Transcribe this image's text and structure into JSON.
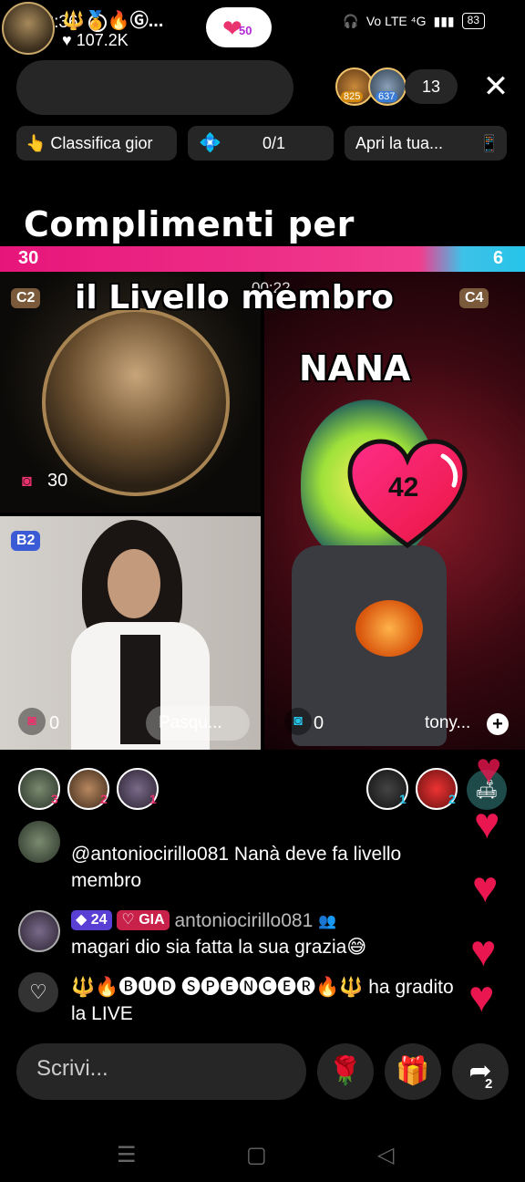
{
  "status": {
    "time": "23:36",
    "right_label": "Vo LTE ⁴G",
    "battery": "83"
  },
  "host": {
    "name": "🔱🏅🔥Ⓖ...",
    "likes": "♥ 107.2K",
    "follow_count": "50"
  },
  "viewers": {
    "v1_badge": "825",
    "v2_badge": "637",
    "count": "13"
  },
  "pills": {
    "ranking": "👆 Classifica gior",
    "progress": "0/1",
    "open": "Apri la tua..."
  },
  "overlay": {
    "congrats": "Complimenti per",
    "level": "il Livello membro",
    "timer": "00:22",
    "nana": "NANA"
  },
  "pk": {
    "left": "30",
    "right": "6"
  },
  "tiles": {
    "t1": {
      "badge": "C2",
      "count": "30"
    },
    "t2": {
      "badge": "C4",
      "heart_value": "42"
    },
    "t3": {
      "badge": "B2",
      "count": "0",
      "name": "Pasqu..."
    },
    "t4": {
      "count": "0",
      "name": "tony..."
    }
  },
  "gifters": {
    "left": [
      "3",
      "2",
      "1"
    ],
    "right": [
      "1",
      "2"
    ]
  },
  "chat": {
    "m1": {
      "text": "@antoniocirillo081 Nanà deve fa livello membro"
    },
    "m2": {
      "level": "24",
      "tag": "GIA",
      "user": "antoniocirillo081",
      "text": "magari dio sia fatta la sua grazia😅"
    },
    "m3": {
      "text": "🔱🔥🅑🅤🅓 🅢🅟🅔🅝🅒🅔🅡🔥🔱 ha gradito la LIVE"
    }
  },
  "input": {
    "placeholder": "Scrivi..."
  },
  "share_count": "2",
  "colors": {
    "accent": "#e7157a",
    "blue": "#27c4e9",
    "heart": "#e9164f"
  }
}
